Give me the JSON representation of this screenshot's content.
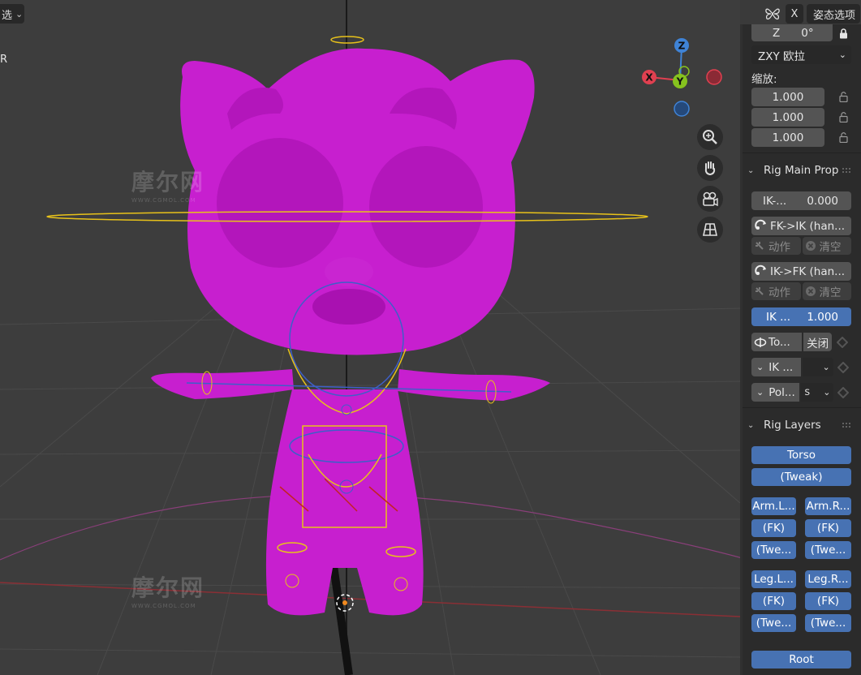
{
  "header": {
    "left_select_label": "选",
    "close_label": "X",
    "pose_options_label": "姿态选项"
  },
  "viewport": {
    "corner_label": "R",
    "watermark_text": "摩尔网",
    "watermark_sub": "WWW.CGMOL.COM",
    "gizmo": {
      "z_label": "Z",
      "y_label": "Y",
      "x_label": "X"
    },
    "colors": {
      "model": "#c71fcf",
      "x_axis": "#e04050",
      "y_axis": "#86c21e",
      "z_axis": "#3f83d6",
      "rig_yellow": "#e8c21a",
      "rig_blue": "#3e5fc8"
    }
  },
  "transform": {
    "z_axis_label": "Z",
    "z_value": "0°",
    "rotation_mode": "ZXY 欧拉",
    "scale_label": "缩放:",
    "scale_values": [
      "1.000",
      "1.000",
      "1.000"
    ]
  },
  "rig_main": {
    "title": "Rig Main Prop",
    "ik_label": "IK-...",
    "ik_value": "0.000",
    "fk_ik_label": "FK->IK (han...",
    "ik_fk_label": "IK->FK (han...",
    "action_label": "动作",
    "clear_label": "清空",
    "ik_stretch_label": "IK ...",
    "ik_stretch_value": "1.000",
    "toggle_label": "To...",
    "toggle_value": "关闭",
    "ik_dropdown_label": "IK ...",
    "pole_label": "Pol...",
    "pole_value": "s"
  },
  "rig_layers": {
    "title": "Rig Layers",
    "torso": "Torso",
    "tweak": "(Tweak)",
    "arm_left": "Arm.L...",
    "arm_right": "Arm.R...",
    "fk": "(FK)",
    "twe": "(Twe...",
    "leg_left": "Leg.L...",
    "leg_right": "Leg.R...",
    "root": "Root"
  }
}
